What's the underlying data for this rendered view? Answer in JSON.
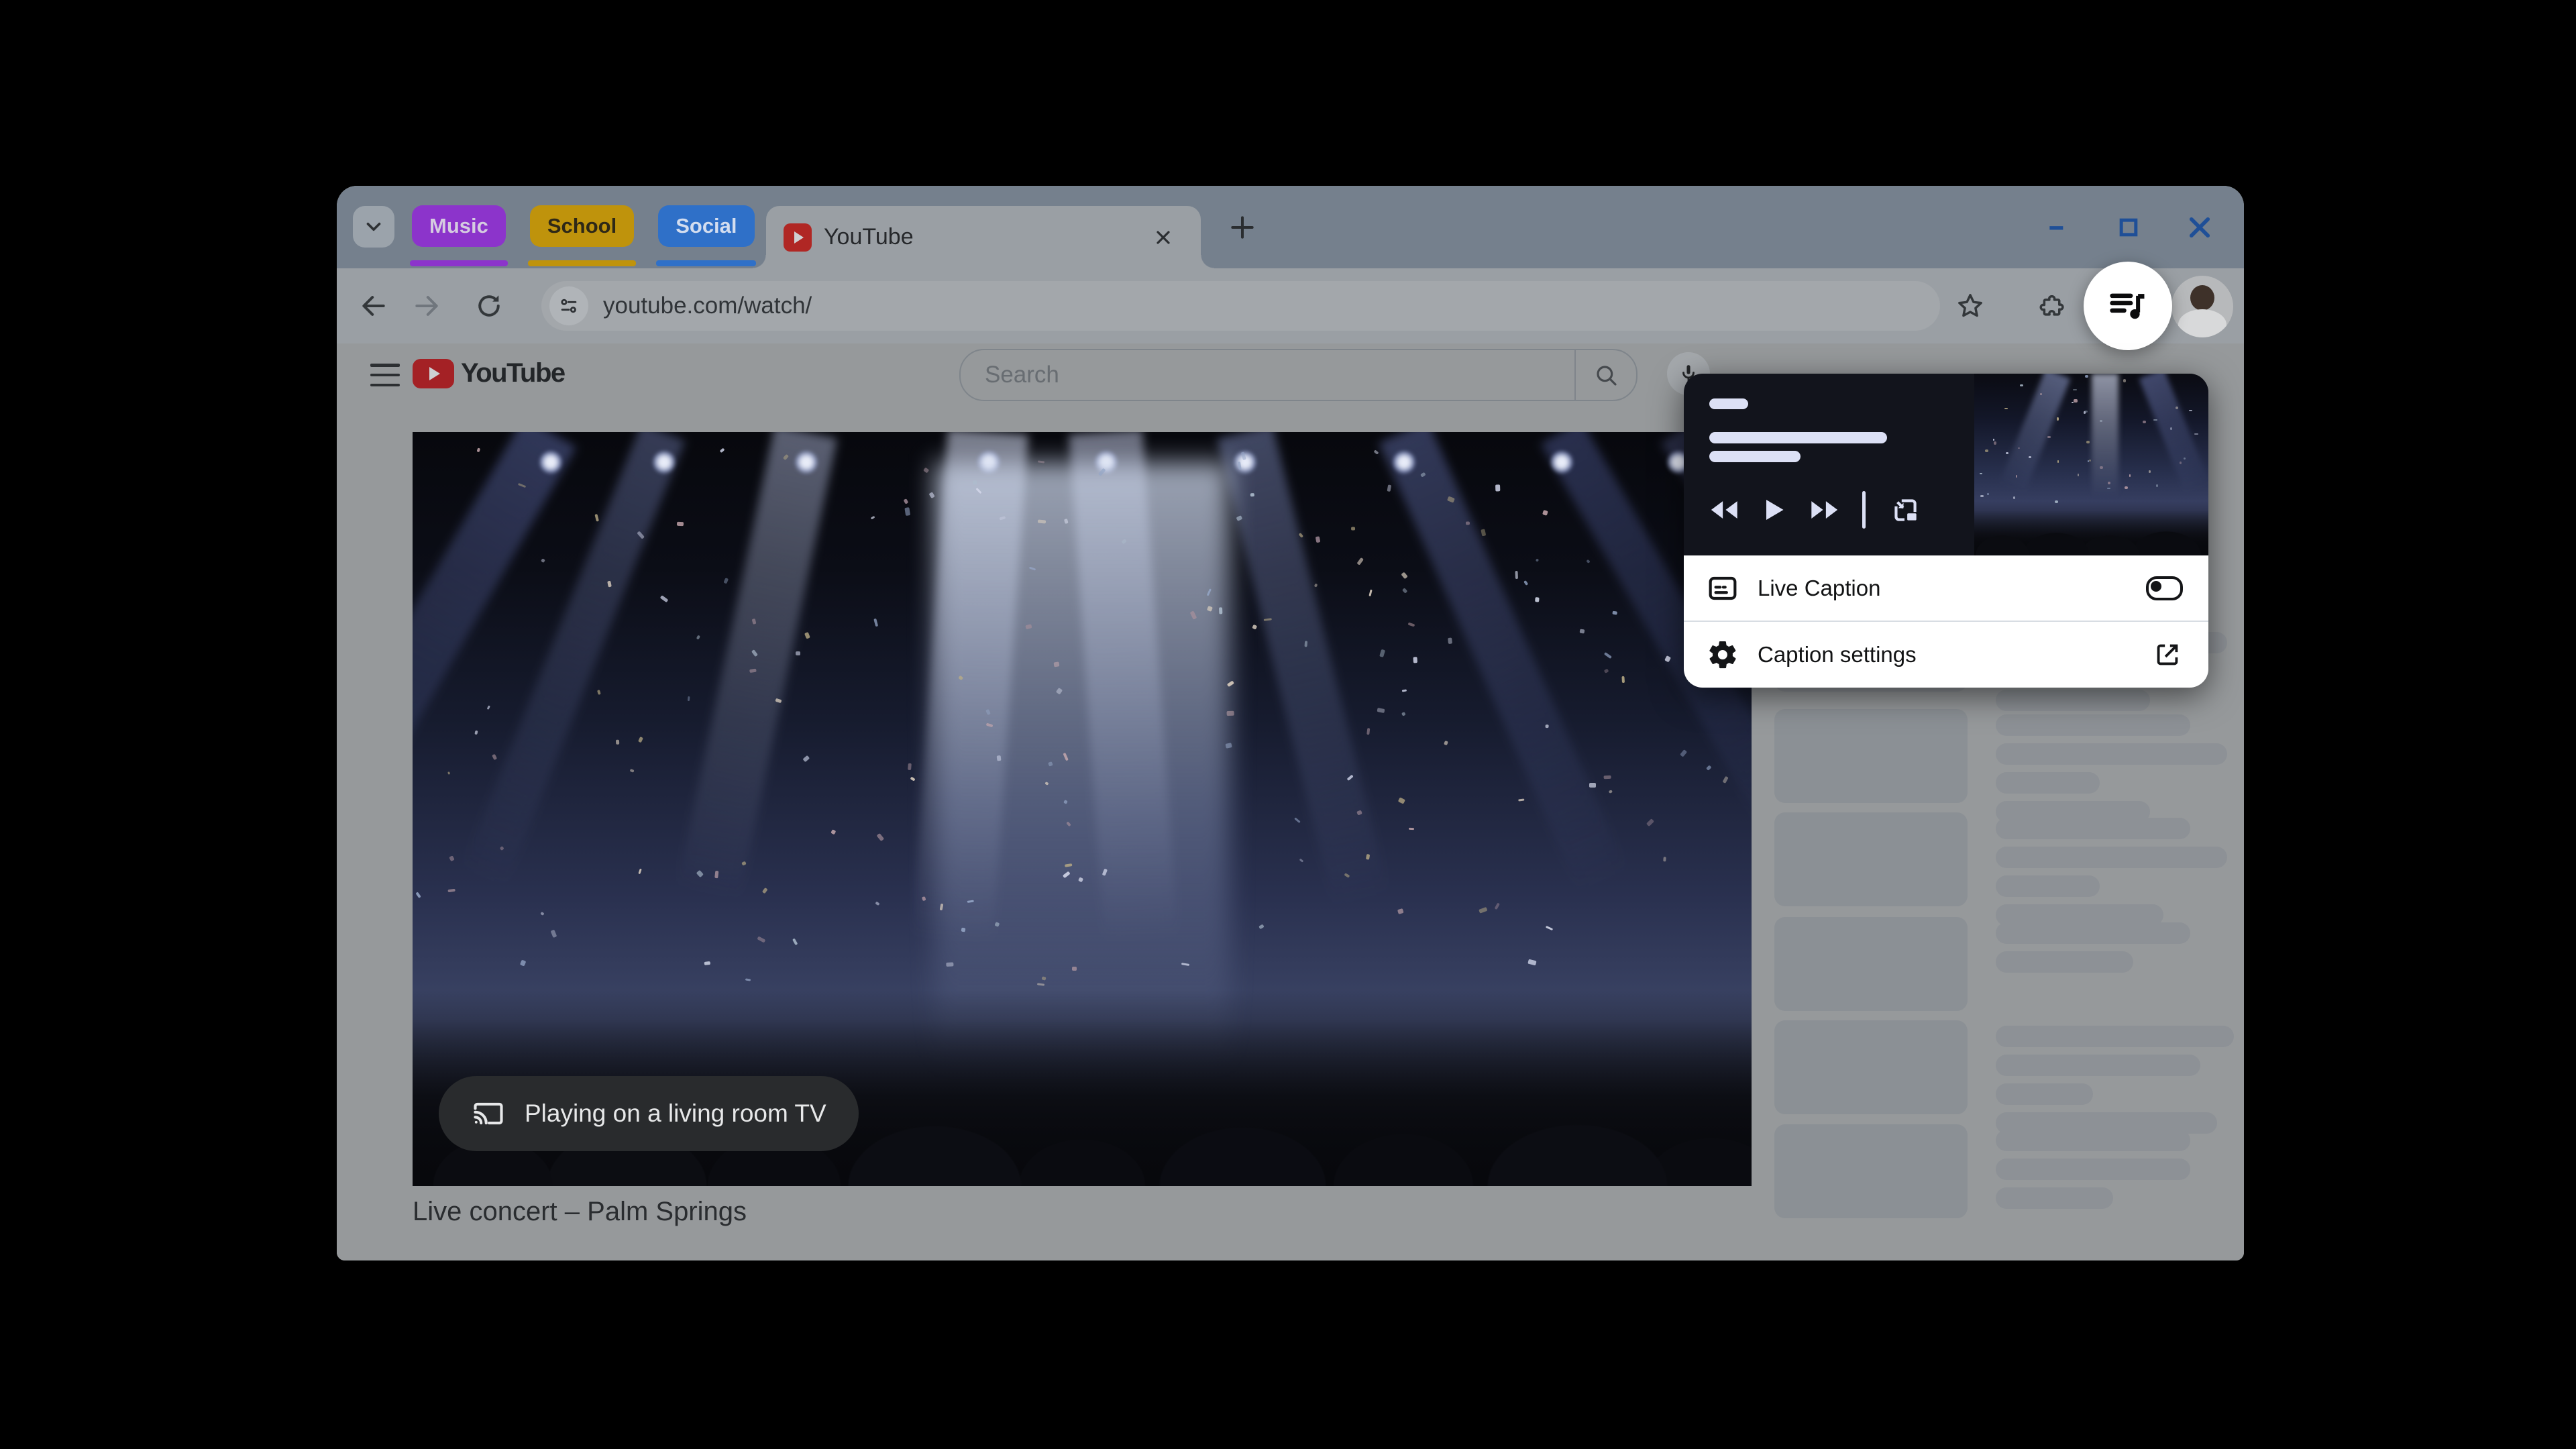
{
  "tab_strip": {
    "groups": [
      {
        "label": "Music",
        "color": "#8C34CB",
        "text_color": "#D5CBE0"
      },
      {
        "label": "School",
        "color": "#BF930C",
        "text_color": "#2E2817"
      },
      {
        "label": "Social",
        "color": "#2F70C8",
        "text_color": "#D3DDEF"
      }
    ],
    "active_tab": {
      "title": "YouTube",
      "favicon": "youtube-favicon"
    }
  },
  "toolbar": {
    "url": "youtube.com/watch/"
  },
  "youtube": {
    "logo_text": "YouTube",
    "search_placeholder": "Search",
    "cast_status": "Playing on a living room TV",
    "video_title": "Live concert – Palm Springs"
  },
  "media_popup": {
    "rows": [
      {
        "label": "Live Caption",
        "control": "toggle",
        "state": "off"
      },
      {
        "label": "Caption settings",
        "control": "open-in-new"
      }
    ]
  },
  "sidebar": {
    "skeleton_items": [
      {
        "bars": [
          290,
          345,
          155,
          230
        ]
      },
      {
        "bars": [
          290,
          345,
          155,
          230
        ]
      },
      {
        "bars": [
          290,
          345,
          155,
          250
        ]
      },
      {
        "bars": [
          290,
          205
        ]
      },
      {
        "bars": [
          355,
          305,
          145,
          330
        ]
      },
      {
        "bars": [
          290,
          290,
          175
        ]
      }
    ]
  },
  "colors": {
    "group_music": "#8C34CB",
    "group_school": "#BF930C",
    "group_social": "#2F70C8",
    "window_controls": "#1F4F97",
    "favicon_red": "#B02724",
    "logo_red": "#A42125",
    "popup_dark": "#12141C",
    "popup_bars": "#DCE0F5",
    "scrim_page": "#96999B"
  }
}
